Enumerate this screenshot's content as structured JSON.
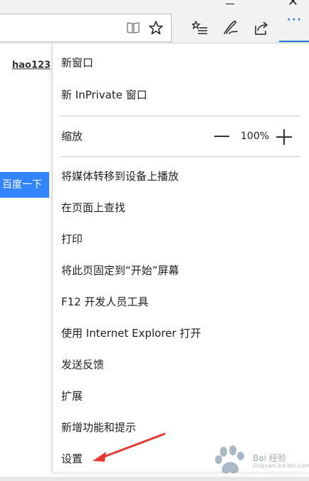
{
  "page": {
    "left_link": "hao123",
    "search_button_label": "百度一下"
  },
  "toolbar": {
    "icons": [
      "reading-view-icon",
      "favorite-star-icon",
      "hub-icon",
      "make-web-note-icon",
      "share-icon",
      "more-actions-icon"
    ],
    "more_actions_glyph": "⋯",
    "active_color": "#1e73c8"
  },
  "menu": {
    "items": [
      {
        "id": "new-window",
        "label": "新窗口"
      },
      {
        "id": "new-inprivate-window",
        "label": "新 InPrivate 窗口"
      },
      {
        "id": "cast-media",
        "label": "将媒体转移到设备上播放"
      },
      {
        "id": "find-on-page",
        "label": "在页面上查找"
      },
      {
        "id": "print",
        "label": "打印"
      },
      {
        "id": "pin-to-start",
        "label": "将此页固定到“开始”屏幕"
      },
      {
        "id": "f12-tools",
        "label": "F12 开发人员工具"
      },
      {
        "id": "open-with-ie",
        "label": "使用 Internet Explorer 打开"
      },
      {
        "id": "send-feedback",
        "label": "发送反馈"
      },
      {
        "id": "extensions",
        "label": "扩展"
      },
      {
        "id": "whats-new-tips",
        "label": "新增功能和提示"
      },
      {
        "id": "settings",
        "label": "设置"
      }
    ],
    "zoom": {
      "label": "缩放",
      "value": "100%"
    }
  },
  "annotation": {
    "arrow_color": "#e53935"
  },
  "watermark": {
    "text": "Bai 经验",
    "subtext": "jingyan.baidu.com"
  }
}
